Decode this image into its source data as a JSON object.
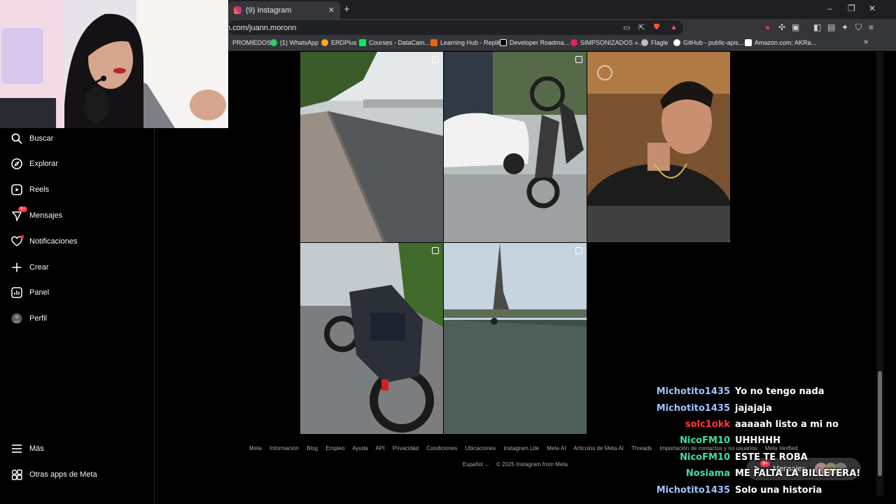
{
  "browser": {
    "tab_title": "(9) Instagram",
    "tab_close": "✕",
    "new_tab": "+",
    "window_controls": [
      "–",
      "❐",
      "✕"
    ],
    "url": "m.com/juann.moronn",
    "bookmarks": [
      {
        "label": "PROMIEDOS",
        "color": "#2e7d32"
      },
      {
        "label": "(1) WhatsApp",
        "color": "#25d366"
      },
      {
        "label": "ERDPlus",
        "color": "#f9a825"
      },
      {
        "label": "Courses - DataCam...",
        "color": "#03ef62"
      },
      {
        "label": "Learning Hub - Replit",
        "color": "#f26207"
      },
      {
        "label": "Developer Roadma...",
        "color": "#ffffff"
      },
      {
        "label": "SIMPSONIZADOS »...",
        "color": "#e91e63"
      },
      {
        "label": "Flagle",
        "color": "#9e9e9e"
      },
      {
        "label": "GitHub - public-apis...",
        "color": "#ffffff"
      },
      {
        "label": "Amazon.com: AKRa...",
        "color": "#ffffff"
      }
    ],
    "bookmarks_more": "»"
  },
  "sidebar": {
    "items": [
      {
        "label": "Buscar",
        "icon": "search-icon"
      },
      {
        "label": "Explorar",
        "icon": "compass-icon"
      },
      {
        "label": "Reels",
        "icon": "reels-icon"
      },
      {
        "label": "Mensajes",
        "icon": "messenger-icon",
        "badge": "9+"
      },
      {
        "label": "Notificaciones",
        "icon": "heart-icon"
      },
      {
        "label": "Crear",
        "icon": "plus-icon"
      },
      {
        "label": "Panel",
        "icon": "dashboard-icon"
      },
      {
        "label": "Perfil",
        "icon": "avatar-icon"
      }
    ],
    "more": {
      "label": "Más",
      "icon": "menu-icon"
    },
    "meta_apps": {
      "label": "Otras apps de Meta",
      "icon": "meta-apps-icon"
    }
  },
  "grid": {
    "posts": [
      {
        "kind": "reel",
        "scene": "street sidewalk"
      },
      {
        "kind": "reel",
        "scene": "motorcycle wheelie"
      },
      {
        "kind": "photo",
        "scene": "portrait"
      },
      {
        "kind": "photo",
        "scene": "parked motorcycle"
      },
      {
        "kind": "reel",
        "scene": "road with rider"
      }
    ]
  },
  "footer": {
    "links": [
      "Meta",
      "Información",
      "Blog",
      "Empleo",
      "Ayuda",
      "API",
      "Privacidad",
      "Condiciones",
      "Ubicaciones",
      "Instagram Lite",
      "Meta AI",
      "Artículos de Meta AI",
      "Threads",
      "Importación de contactos y no usuarios",
      "Meta Verified"
    ],
    "language": "Español ⌵",
    "copyright": "© 2025 Instagram from Meta"
  },
  "chat": {
    "messages": [
      {
        "user": "Michotito1435",
        "text": "Yo no tengo nada",
        "color": "#9ec3ff"
      },
      {
        "user": "Michotito1435",
        "text": "jajajaja",
        "color": "#9ec3ff"
      },
      {
        "user": "solc1okk",
        "text": "aaaaah listo a mi no",
        "color": "#ff3b3b"
      },
      {
        "user": "NicoFM10",
        "text": "UHHHHH",
        "color": "#3fe0a0"
      },
      {
        "user": "NicoFM10",
        "text": "ESTE TE ROBA",
        "color": "#3fe0a0"
      },
      {
        "user": "Nosiama",
        "text": "ME FALTA LA BILLETERA!",
        "color": "#3fe0a0"
      },
      {
        "user": "Michotito1435",
        "text": "Solo una historia",
        "color": "#9ec3ff"
      }
    ]
  },
  "messages_pill": {
    "label": "Mensajes",
    "badge": "9+"
  }
}
